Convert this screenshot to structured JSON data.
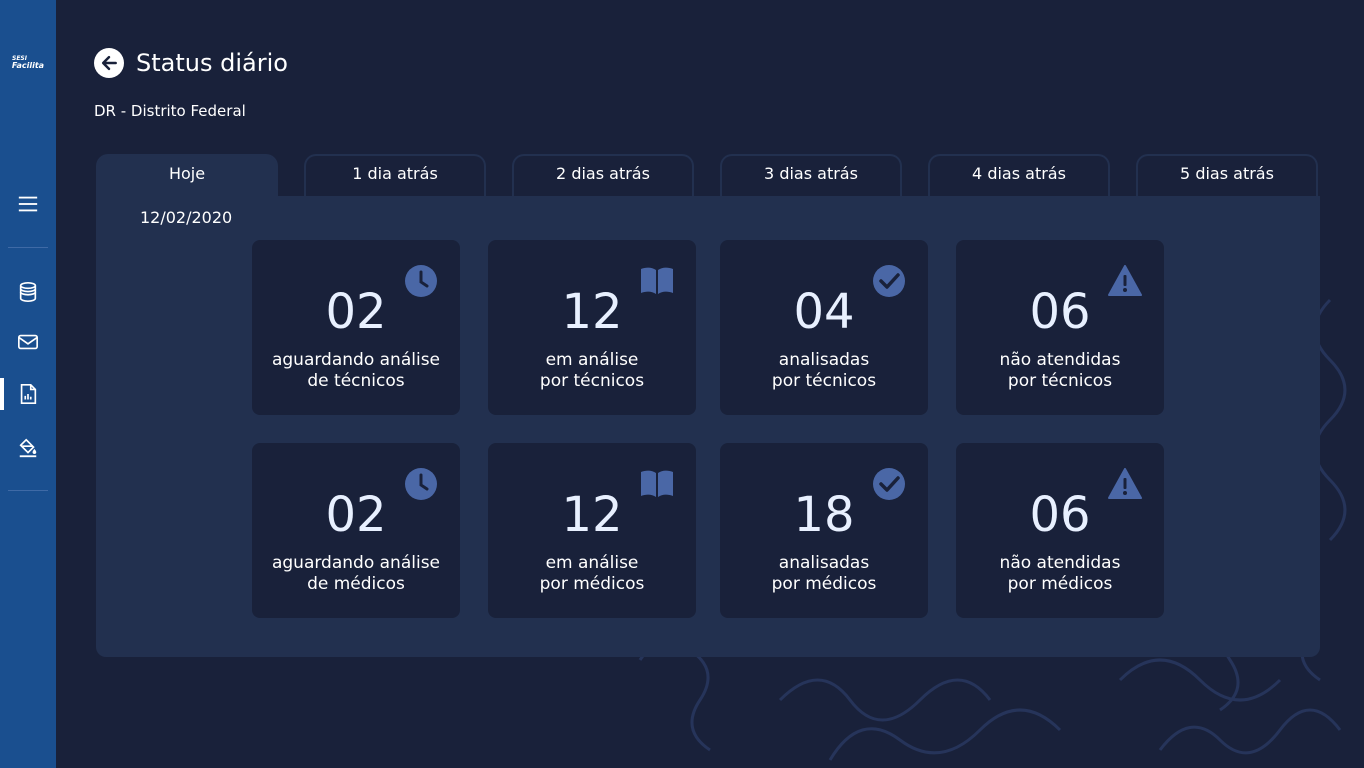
{
  "app": {
    "logo_line1": "SESI",
    "logo_line2": "Facilita"
  },
  "header": {
    "title": "Status diário",
    "subtitle": "DR - Distrito Federal"
  },
  "tabs": [
    {
      "label": "Hoje",
      "active": true
    },
    {
      "label": "1 dia atrás",
      "active": false
    },
    {
      "label": "2 dias atrás",
      "active": false
    },
    {
      "label": "3 dias atrás",
      "active": false
    },
    {
      "label": "4 dias atrás",
      "active": false
    },
    {
      "label": "5 dias atrás",
      "active": false
    }
  ],
  "date": "12/02/2020",
  "cards": [
    {
      "value": "02",
      "line1": "aguardando análise",
      "line2": "de técnicos",
      "icon": "clock-icon"
    },
    {
      "value": "12",
      "line1": "em análise",
      "line2": "por técnicos",
      "icon": "book-icon"
    },
    {
      "value": "04",
      "line1": "analisadas",
      "line2": "por técnicos",
      "icon": "check-circle-icon"
    },
    {
      "value": "06",
      "line1": "não atendidas",
      "line2": "por técnicos",
      "icon": "warning-icon"
    },
    {
      "value": "02",
      "line1": "aguardando análise",
      "line2": "de médicos",
      "icon": "clock-icon"
    },
    {
      "value": "12",
      "line1": "em análise",
      "line2": "por médicos",
      "icon": "book-icon"
    },
    {
      "value": "18",
      "line1": "analisadas",
      "line2": "por médicos",
      "icon": "check-circle-icon"
    },
    {
      "value": "06",
      "line1": "não atendidas",
      "line2": "por médicos",
      "icon": "warning-icon"
    }
  ],
  "sidebar_icons": [
    "menu-icon",
    "database-icon",
    "mail-icon",
    "report-icon",
    "paint-bucket-icon"
  ],
  "colors": {
    "sidebar": "#1a4f8f",
    "background": "#19213a",
    "panel": "#22304f",
    "card": "#19213a",
    "icon": "#4a67a6"
  }
}
